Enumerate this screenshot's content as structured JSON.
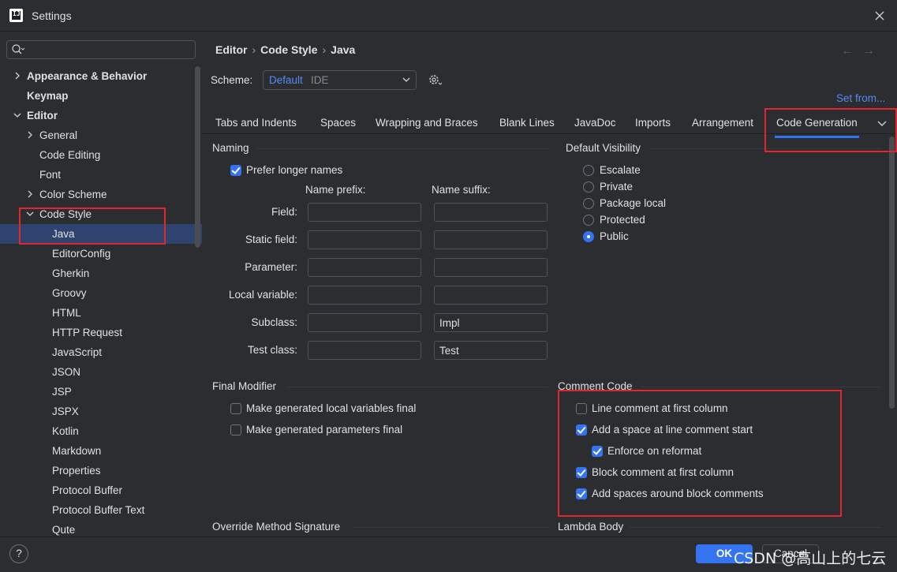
{
  "window": {
    "title": "Settings",
    "logo_text": "IJ"
  },
  "sidebar": {
    "search_placeholder": "",
    "items": [
      {
        "label": "Appearance & Behavior",
        "depth": 0,
        "bold": true,
        "chevron": "right"
      },
      {
        "label": "Keymap",
        "depth": 0,
        "bold": true,
        "chevron": "none"
      },
      {
        "label": "Editor",
        "depth": 0,
        "bold": true,
        "chevron": "down"
      },
      {
        "label": "General",
        "depth": 1,
        "chevron": "right"
      },
      {
        "label": "Code Editing",
        "depth": 1,
        "chevron": "none"
      },
      {
        "label": "Font",
        "depth": 1,
        "chevron": "none"
      },
      {
        "label": "Color Scheme",
        "depth": 1,
        "chevron": "right"
      },
      {
        "label": "Code Style",
        "depth": 1,
        "chevron": "down"
      },
      {
        "label": "Java",
        "depth": 2,
        "chevron": "none",
        "selected": true
      },
      {
        "label": "EditorConfig",
        "depth": 2,
        "chevron": "none"
      },
      {
        "label": "Gherkin",
        "depth": 2,
        "chevron": "none"
      },
      {
        "label": "Groovy",
        "depth": 2,
        "chevron": "none"
      },
      {
        "label": "HTML",
        "depth": 2,
        "chevron": "none"
      },
      {
        "label": "HTTP Request",
        "depth": 2,
        "chevron": "none"
      },
      {
        "label": "JavaScript",
        "depth": 2,
        "chevron": "none"
      },
      {
        "label": "JSON",
        "depth": 2,
        "chevron": "none"
      },
      {
        "label": "JSP",
        "depth": 2,
        "chevron": "none"
      },
      {
        "label": "JSPX",
        "depth": 2,
        "chevron": "none"
      },
      {
        "label": "Kotlin",
        "depth": 2,
        "chevron": "none"
      },
      {
        "label": "Markdown",
        "depth": 2,
        "chevron": "none"
      },
      {
        "label": "Properties",
        "depth": 2,
        "chevron": "none"
      },
      {
        "label": "Protocol Buffer",
        "depth": 2,
        "chevron": "none"
      },
      {
        "label": "Protocol Buffer Text",
        "depth": 2,
        "chevron": "none"
      },
      {
        "label": "Qute",
        "depth": 2,
        "chevron": "none"
      }
    ]
  },
  "breadcrumb": [
    "Editor",
    "Code Style",
    "Java"
  ],
  "scheme": {
    "label": "Scheme:",
    "name": "Default",
    "type": "IDE",
    "set_from": "Set from..."
  },
  "tabs": [
    {
      "label": "Tabs and Indents"
    },
    {
      "label": "Spaces"
    },
    {
      "label": "Wrapping and Braces"
    },
    {
      "label": "Blank Lines"
    },
    {
      "label": "JavaDoc"
    },
    {
      "label": "Imports"
    },
    {
      "label": "Arrangement"
    },
    {
      "label": "Code Generation",
      "active": true
    }
  ],
  "naming": {
    "title": "Naming",
    "prefer_longer": {
      "label": "Prefer longer names",
      "checked": true
    },
    "prefix_header": "Name prefix:",
    "suffix_header": "Name suffix:",
    "rows": [
      {
        "label": "Field:",
        "prefix": "",
        "suffix": ""
      },
      {
        "label": "Static field:",
        "prefix": "",
        "suffix": ""
      },
      {
        "label": "Parameter:",
        "prefix": "",
        "suffix": ""
      },
      {
        "label": "Local variable:",
        "prefix": "",
        "suffix": ""
      },
      {
        "label": "Subclass:",
        "prefix": "",
        "suffix": "Impl"
      },
      {
        "label": "Test class:",
        "prefix": "",
        "suffix": "Test"
      }
    ]
  },
  "visibility": {
    "title": "Default Visibility",
    "options": [
      {
        "label": "Escalate",
        "checked": false
      },
      {
        "label": "Private",
        "checked": false
      },
      {
        "label": "Package local",
        "checked": false
      },
      {
        "label": "Protected",
        "checked": false
      },
      {
        "label": "Public",
        "checked": true
      }
    ]
  },
  "final_modifier": {
    "title": "Final Modifier",
    "options": [
      {
        "label": "Make generated local variables final",
        "checked": false
      },
      {
        "label": "Make generated parameters final",
        "checked": false
      }
    ]
  },
  "comment_code": {
    "title": "Comment Code",
    "options": [
      {
        "label": "Line comment at first column",
        "checked": false,
        "indent": 0
      },
      {
        "label": "Add a space at line comment start",
        "checked": true,
        "indent": 0
      },
      {
        "label": "Enforce on reformat",
        "checked": true,
        "indent": 1
      },
      {
        "label": "Block comment at first column",
        "checked": true,
        "indent": 0
      },
      {
        "label": "Add spaces around block comments",
        "checked": true,
        "indent": 0
      }
    ]
  },
  "override_title": "Override Method Signature",
  "lambda_title": "Lambda Body",
  "buttons": {
    "help": "?",
    "ok": "OK",
    "cancel": "Cancel"
  },
  "watermark": "CSDN @高山上的七云",
  "colors": {
    "accent": "#3574f0",
    "link": "#548af7",
    "highlight": "#e2262f",
    "selection": "#2e436e"
  }
}
